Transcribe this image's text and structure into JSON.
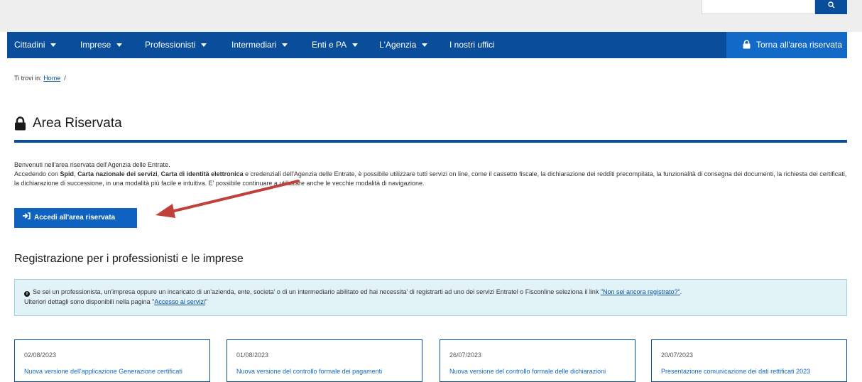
{
  "nav": {
    "items": [
      {
        "label": "Cittadini",
        "caret": true
      },
      {
        "label": "Imprese",
        "caret": true
      },
      {
        "label": "Professionisti",
        "caret": true
      },
      {
        "label": "Intermediari",
        "caret": true
      },
      {
        "label": "Enti e PA",
        "caret": true
      },
      {
        "label": "L'Agenzia",
        "caret": true
      },
      {
        "label": "I nostri uffici",
        "caret": false
      }
    ],
    "reserved_label": "Torna all'area riservata"
  },
  "breadcrumb": {
    "prefix": "Ti trovi in:",
    "home": "Home",
    "sep": "/"
  },
  "page": {
    "title": "Area Riservata"
  },
  "intro": {
    "line1": "Benvenuti nell'area riservata dell'Agenzia delle Entrate.",
    "p2_a": "Accedendo con ",
    "p2_spid": "Spid",
    "p2_comma1": ", ",
    "p2_cns": "Carta nazionale dei servizi",
    "p2_comma2": ", ",
    "p2_cie": "Carta di identità elettronica",
    "p2_b": " e credenziali dell'Agenzia delle Entrate, è possibile utilizzare tutti servizi on line, come il cassetto fiscale, la dichiarazione dei redditi precompilata, la funzionalità di consegna dei documenti, la richiesta dei certificati, la dichiarazione di successione, in una modalità più facile e intuitiva. E' possibile continuare a utilizzare anche le vecchie modalità di navigazione."
  },
  "access_button": {
    "label": "Accedi all'area riservata"
  },
  "registration": {
    "title": "Registrazione per i professionisti e le imprese",
    "info_text": "Se sei un professionista, un'impresa oppure un incaricato di un'azienda, ente, societa' o di un intermediario abilitato ed hai necessita' di registrarti ad uno dei servizi Entratel o Fisconline seleziona il link ",
    "info_link": "\"Non sei ancora registrato?\"",
    "info_end": ".",
    "more_text": "Ulteriori dettagli sono disponibili nella pagina \"",
    "more_link": "Accesso ai servizi",
    "more_end": "\""
  },
  "news": [
    {
      "date": "02/08/2023",
      "title": "Nuova versione dell'applicazione Generazione certificati"
    },
    {
      "date": "01/08/2023",
      "title": "Nuova versione del controllo formale dei pagamenti"
    },
    {
      "date": "26/07/2023",
      "title": "Nuova versione del controllo formale delle dichiarazioni"
    },
    {
      "date": "20/07/2023",
      "title": "Presentazione comunicazione dei dati rettificati 2023"
    }
  ],
  "colors": {
    "primary": "#0a4d9a",
    "accent": "#1369c6",
    "info_bg": "#e2f3f8",
    "annotation_arrow": "#c0413a"
  }
}
